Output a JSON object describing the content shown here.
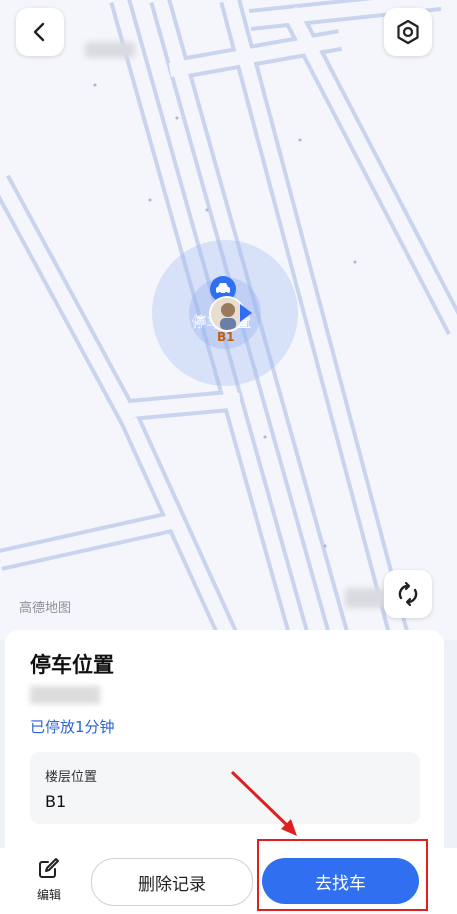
{
  "map": {
    "watermark": "高德地图",
    "pin_label": "停车位置",
    "pin_floor": "B1"
  },
  "sheet": {
    "title": "停车位置",
    "parked_duration": "已停放1分钟",
    "floor_label": "楼层位置",
    "floor_value": "B1"
  },
  "bottom": {
    "edit_label": "编辑",
    "delete_label": "删除记录",
    "find_label": "去找车"
  },
  "colors": {
    "accent": "#2f6ff0",
    "annotation": "#e02020"
  },
  "icons": [
    "back-arrow-icon",
    "settings-hex-icon",
    "refresh-icon",
    "edit-pen-icon",
    "car-icon"
  ]
}
